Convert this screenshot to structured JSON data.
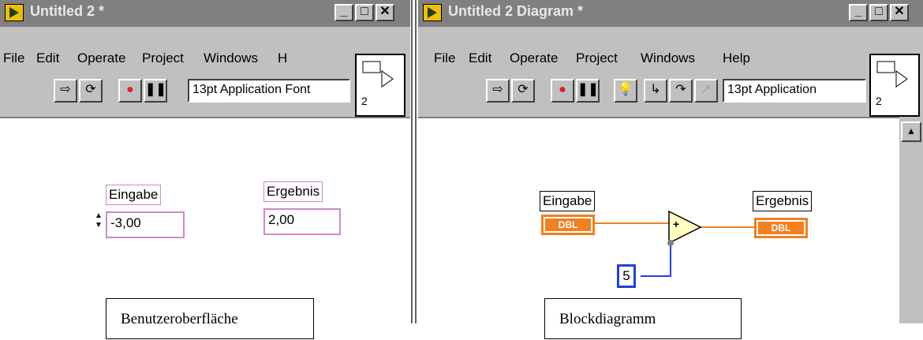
{
  "front_panel": {
    "title": "Untitled 2 *",
    "menu": [
      "File",
      "Edit",
      "Operate",
      "Project",
      "Windows",
      "H"
    ],
    "font": "13pt Application Font",
    "icon_num": "2",
    "input_label": "Eingabe",
    "input_value": "-3,00",
    "output_label": "Ergebnis",
    "output_value": "2,00"
  },
  "diagram": {
    "title": "Untitled 2 Diagram *",
    "menu": [
      "File",
      "Edit",
      "Operate",
      "Project",
      "Windows",
      "Help"
    ],
    "font": "13pt Application",
    "icon_num": "2",
    "input_label": "Eingabe",
    "output_label": "Ergebnis",
    "term_type": "DBL",
    "add_symbol": "+",
    "constant": "5"
  },
  "captions": {
    "left": "Benutzeroberfläche",
    "right": "Blockdiagramm"
  },
  "window_buttons": {
    "min": "_",
    "max": "□",
    "close": "✕"
  },
  "colors": {
    "titlebar": "#808080",
    "wire_orange": "#f08020",
    "wire_blue": "#2040e0",
    "label_border": "#cc88cc"
  }
}
